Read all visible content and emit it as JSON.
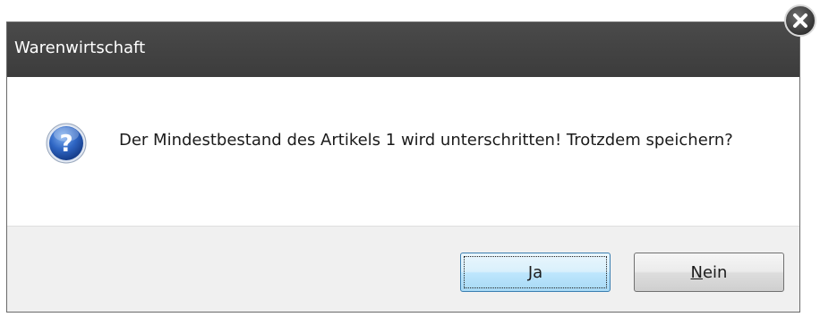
{
  "window": {
    "title": "Warenwirtschaft"
  },
  "message": {
    "text": "Der Mindestbestand des Artikels 1 wird unterschritten! Trotzdem speichern?",
    "icon": "question-icon"
  },
  "buttons": {
    "yes": {
      "mnemonic": "J",
      "rest": "a"
    },
    "no": {
      "mnemonic": "N",
      "rest": "ein"
    }
  },
  "close": {
    "icon": "close-icon"
  },
  "colors": {
    "titlebar": "#3f3f3f",
    "footer": "#f0f0f0",
    "focus_border": "#3c7fb1",
    "icon_blue": "#2a5bb3"
  }
}
